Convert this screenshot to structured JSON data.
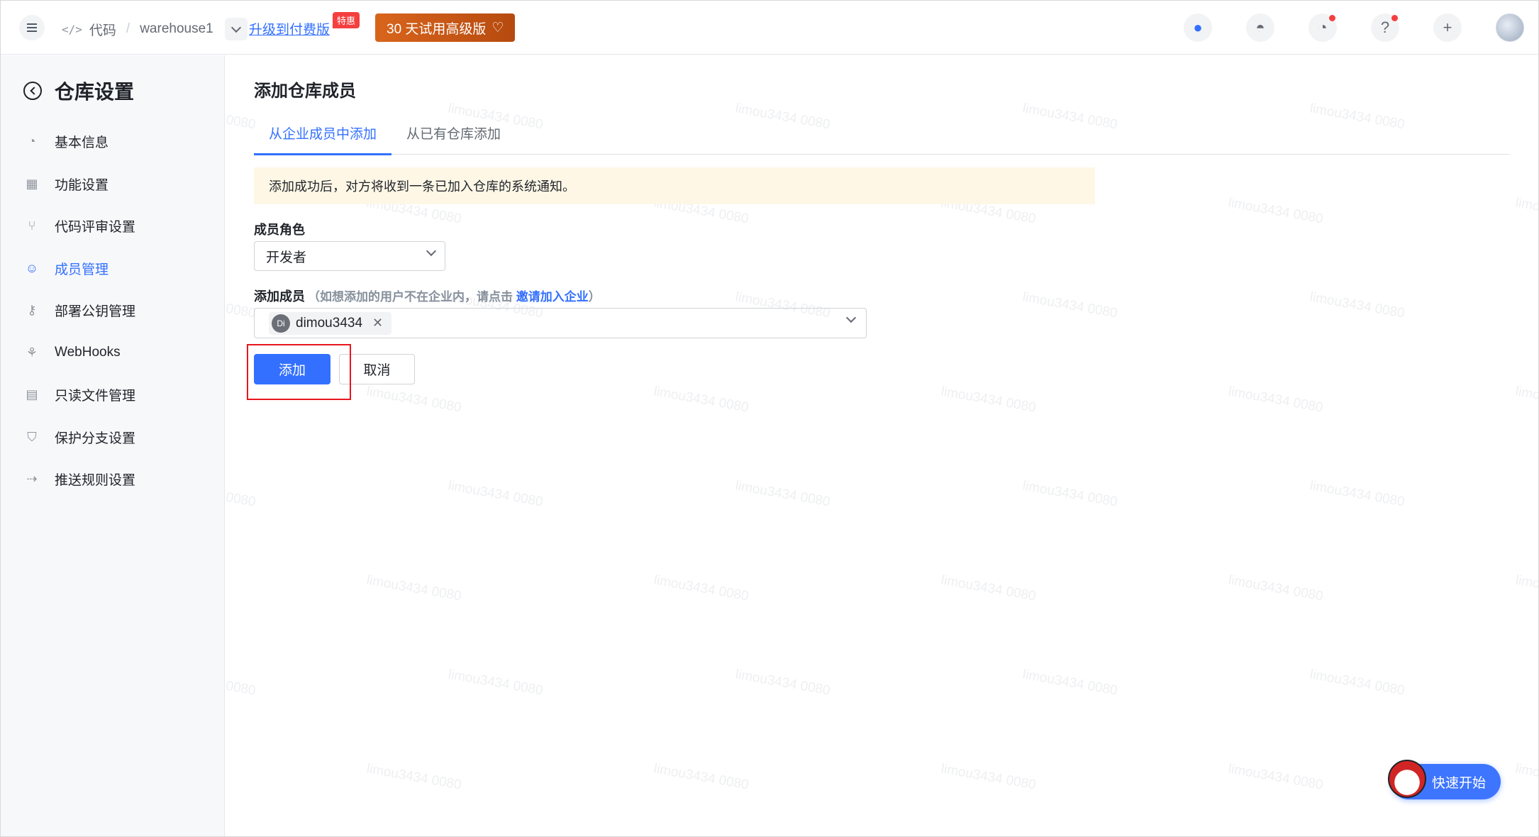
{
  "header": {
    "breadcrumb_code": "代码",
    "breadcrumb_sep": "/",
    "repo_name": "warehouse1",
    "upgrade_link": "升级到付费版",
    "special_badge": "特惠",
    "trial_button": "30 天试用高级版",
    "icons": [
      "chat-bot-icon",
      "avatar-ghost-icon",
      "bell-icon",
      "help-icon",
      "plus-icon",
      "user-avatar"
    ]
  },
  "sidebar": {
    "title": "仓库设置",
    "items": [
      {
        "label": "基本信息",
        "icon": "gauge-icon"
      },
      {
        "label": "功能设置",
        "icon": "grid-icon"
      },
      {
        "label": "代码评审设置",
        "icon": "merge-icon"
      },
      {
        "label": "成员管理",
        "icon": "users-icon",
        "active": true
      },
      {
        "label": "部署公钥管理",
        "icon": "key-icon"
      },
      {
        "label": "WebHooks",
        "icon": "webhook-icon"
      },
      {
        "label": "只读文件管理",
        "icon": "file-lock-icon"
      },
      {
        "label": "保护分支设置",
        "icon": "branch-shield-icon"
      },
      {
        "label": "推送规则设置",
        "icon": "push-rule-icon"
      }
    ]
  },
  "main": {
    "page_title": "添加仓库成员",
    "tabs": [
      {
        "label": "从企业成员中添加",
        "active": true
      },
      {
        "label": "从已有仓库添加",
        "active": false
      }
    ],
    "notice": "添加成功后，对方将收到一条已加入仓库的系统通知。",
    "role_label": "成员角色",
    "role_value": "开发者",
    "member_label": "添加成员",
    "member_hint_prefix": "（如想添加的用户不在企业内，请点击",
    "member_hint_link": "邀请加入企业",
    "member_hint_suffix": "）",
    "selected_member_avatar": "Di",
    "selected_member_name": "dimou3434",
    "add_button": "添加",
    "cancel_button": "取消"
  },
  "quick_start": "快速开始",
  "watermark_text": "limou3434 0080",
  "colors": {
    "accent": "#3370ff",
    "trial_orange": "#c9561a",
    "notice_bg": "#fef7e6",
    "highlight_red": "#e8161d"
  }
}
